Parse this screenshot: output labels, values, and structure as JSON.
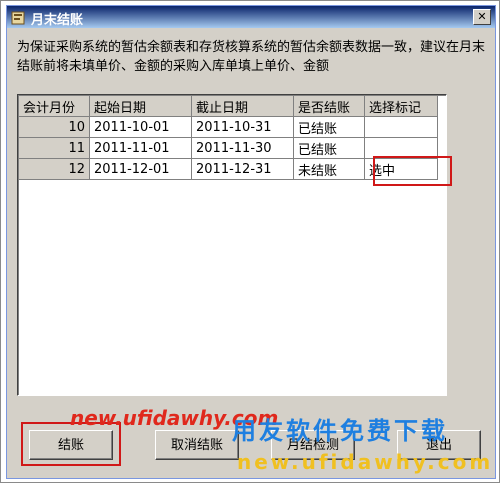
{
  "window": {
    "title": "月末结账",
    "close_glyph": "✕"
  },
  "description": "为保证采购系统的暂估余额表和存货核算系统的暂估余额表数据一致，建议在月末结账前将未填单价、金额的采购入库单填上单价、金额",
  "table": {
    "headers": [
      "会计月份",
      "起始日期",
      "截止日期",
      "是否结账",
      "选择标记"
    ],
    "rows": [
      [
        "10",
        "2011-10-01",
        "2011-10-31",
        "已结账",
        ""
      ],
      [
        "11",
        "2011-11-01",
        "2011-11-30",
        "已结账",
        ""
      ],
      [
        "12",
        "2011-12-01",
        "2011-12-31",
        "未结账",
        "选中"
      ]
    ]
  },
  "buttons": {
    "close_period": "结账",
    "cancel_close": "取消结账",
    "check": "月结检测",
    "exit": "退出"
  },
  "watermark": {
    "url_top": "new.ufidawhy.com",
    "slogan": "用友软件免费下载",
    "url_bottom": "new.ufidawhy.com"
  },
  "colors": {
    "highlight": "#d01818",
    "title_bar": "#0a246a",
    "window_bg": "#d4d0c8"
  }
}
